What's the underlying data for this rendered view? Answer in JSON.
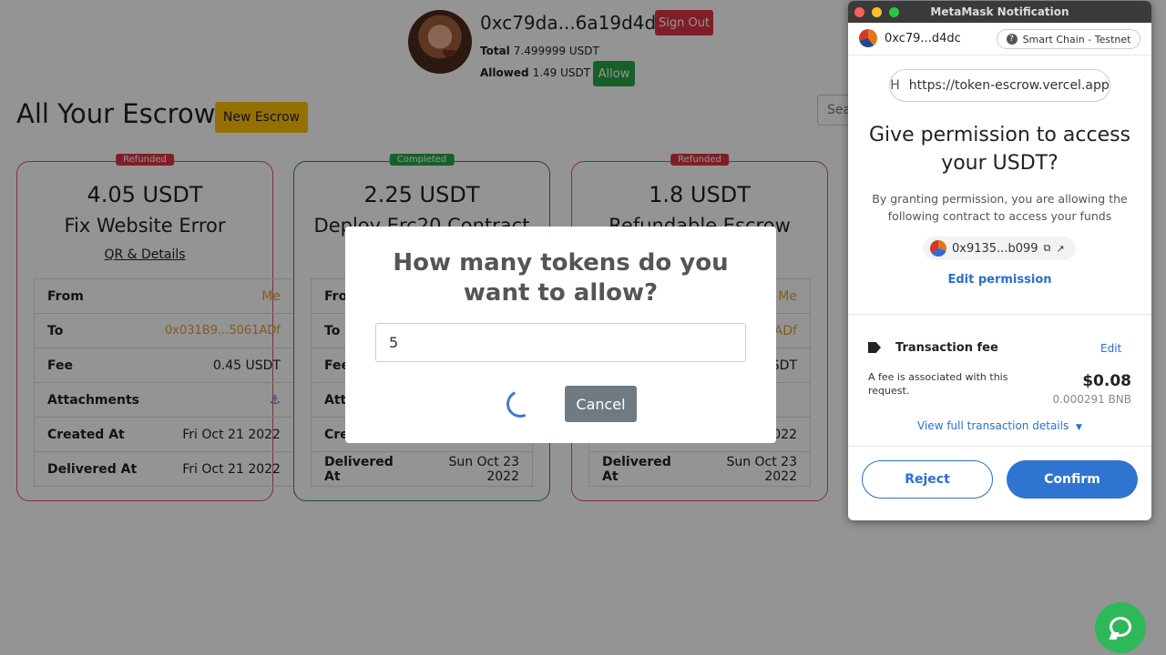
{
  "header": {
    "address": "0xc79da...6a19d4d",
    "sign_out_label": "Sign Out",
    "total_label": "Total",
    "total_value": "7.499999 USDT",
    "allowed_label": "Allowed",
    "allowed_value": "1.49 USDT",
    "allow_label": "Allow"
  },
  "main": {
    "heading": "All Your Escrows",
    "new_escrow_label": "New Escrow",
    "search_placeholder": "Search"
  },
  "cards": [
    {
      "status": "Refunded",
      "amount": "4.05 USDT",
      "title": "Fix Website Error",
      "link": "QR & Details",
      "rows": [
        {
          "k": "From",
          "v": "Me"
        },
        {
          "k": "To",
          "v": "0x031B9...5061ADf"
        },
        {
          "k": "Fee",
          "v": "0.45 USDT"
        },
        {
          "k": "Attachments",
          "v": "⚓"
        },
        {
          "k": "Created At",
          "v": "Fri Oct 21 2022"
        },
        {
          "k": "Delivered At",
          "v": "Fri Oct 21 2022"
        }
      ]
    },
    {
      "status": "Completed",
      "amount": "2.25 USDT",
      "title": "Deploy Erc20 Contract",
      "rows": [
        {
          "k": "Fro",
          "v": ""
        },
        {
          "k": "To",
          "v": ""
        },
        {
          "k": "Fee",
          "v": ""
        },
        {
          "k": "Atta",
          "v": ""
        },
        {
          "k": "Cre",
          "v": ""
        },
        {
          "k": "Delivered At",
          "v": "Sun Oct 23 2022"
        }
      ]
    },
    {
      "status": "Refunded",
      "amount": "1.8 USDT",
      "title": "Refundable Escrow",
      "rows": [
        {
          "k": "",
          "v": "Me"
        },
        {
          "k": "",
          "v": "ADf"
        },
        {
          "k": "",
          "v": "SDT"
        },
        {
          "k": "",
          "v": ""
        },
        {
          "k": "",
          "v": "022"
        },
        {
          "k": "Delivered At",
          "v": "Sun Oct 23 2022"
        }
      ]
    }
  ],
  "modal": {
    "question": "How many tokens do you want to allow?",
    "input_value": "5",
    "cancel_label": "Cancel"
  },
  "metamask": {
    "window_title": "MetaMask Notification",
    "account": "0xc79...d4dc",
    "network": "Smart Chain - Testnet",
    "site_initial": "H",
    "site_url": "https://token-escrow.vercel.app",
    "permission_title": "Give permission to access your USDT?",
    "permission_desc": "By granting permission, you are allowing the following contract to access your funds",
    "contract": "0x9135...b099",
    "edit_permission": "Edit permission",
    "fee_label": "Transaction fee",
    "fee_edit": "Edit",
    "fee_note": "A fee is associated with this request.",
    "fee_usd": "$0.08",
    "fee_bnb": "0.000291 BNB",
    "view_details": "View full transaction details",
    "reject_label": "Reject",
    "confirm_label": "Confirm"
  },
  "colors": {
    "refunded": "#dc3545",
    "completed": "#28a745",
    "accent_blue": "#2f74d0",
    "warning": "#ffc107"
  }
}
